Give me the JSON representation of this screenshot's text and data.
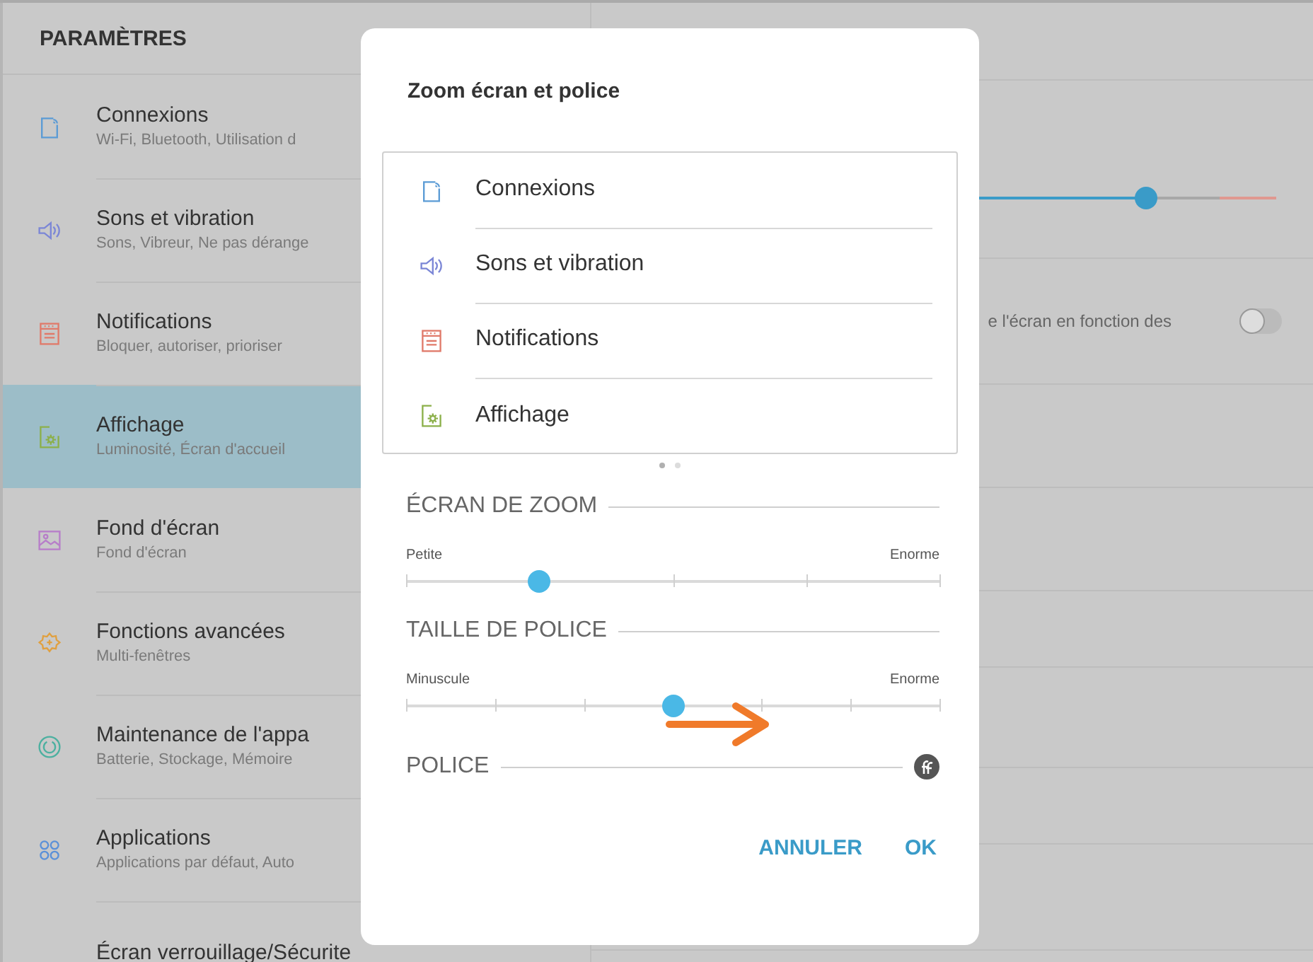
{
  "sidebar": {
    "title": "PARAMÈTRES",
    "items": [
      {
        "kind": "connections",
        "title": "Connexions",
        "subtitle": "Wi-Fi, Bluetooth, Utilisation d",
        "selected": false
      },
      {
        "kind": "sound",
        "title": "Sons et vibration",
        "subtitle": "Sons, Vibreur, Ne pas dérange",
        "selected": false
      },
      {
        "kind": "notifications",
        "title": "Notifications",
        "subtitle": "Bloquer, autoriser, prioriser",
        "selected": false
      },
      {
        "kind": "display",
        "title": "Affichage",
        "subtitle": "Luminosité, Écran d'accueil",
        "selected": true
      },
      {
        "kind": "wallpaper",
        "title": "Fond d'écran",
        "subtitle": "Fond d'écran",
        "selected": false
      },
      {
        "kind": "advanced",
        "title": "Fonctions avancées",
        "subtitle": "Multi-fenêtres",
        "selected": false
      },
      {
        "kind": "maintenance",
        "title": "Maintenance de l'appa",
        "subtitle": "Batterie, Stockage, Mémoire",
        "selected": false
      },
      {
        "kind": "apps",
        "title": "Applications",
        "subtitle": "Applications par défaut, Auto",
        "selected": false
      },
      {
        "kind": "lock",
        "title": "Écran verrouillage/Sécurite",
        "selected": false
      }
    ]
  },
  "content": {
    "brightness": {
      "level": 0.8
    },
    "auto_setting": {
      "label": "e l'écran en fonction des",
      "on": false
    }
  },
  "dialog": {
    "title": "Zoom écran et police",
    "preview_items": [
      {
        "kind": "connections",
        "title": "Connexions"
      },
      {
        "kind": "sound",
        "title": "Sons et vibration"
      },
      {
        "kind": "notifications",
        "title": "Notifications"
      },
      {
        "kind": "display",
        "title": "Affichage"
      }
    ],
    "page_dots": [
      {
        "selected": true
      },
      {
        "selected": false
      }
    ],
    "sections": [
      {
        "kind": "zoom",
        "title": "ÉCRAN DE ZOOM",
        "min_label": "Petite",
        "max_label": "Enorme",
        "level": 0.25
      },
      {
        "kind": "font-size",
        "title": "TAILLE DE POLICE",
        "min_label": "Minuscule",
        "max_label": "Enorme",
        "level": 0.5
      },
      {
        "kind": "font",
        "title": "POLICE"
      }
    ],
    "buttons": [
      "ANNULER",
      "OK"
    ]
  }
}
